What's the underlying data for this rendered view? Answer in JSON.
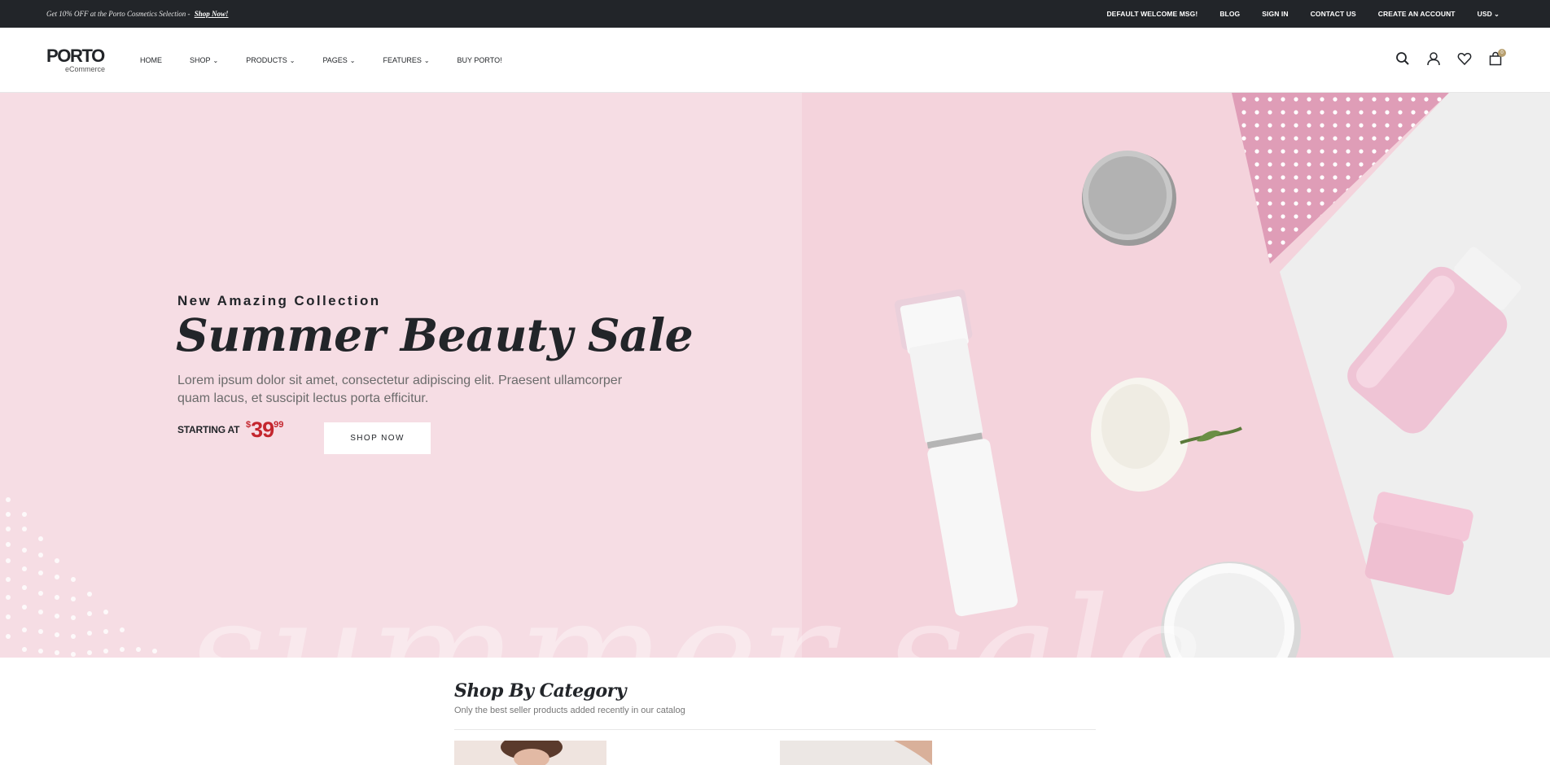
{
  "topbar": {
    "promo_text": "Get 10% OFF at the Porto Cosmetics Selection -",
    "promo_link": "Shop Now!",
    "links": [
      "DEFAULT WELCOME MSG!",
      "BLOG",
      "SIGN IN",
      "CONTACT US",
      "CREATE AN ACCOUNT",
      "USD"
    ]
  },
  "header": {
    "logo_brand": "PORTO",
    "logo_sub": "eCommerce",
    "nav": [
      {
        "label": "HOME",
        "chevron": false
      },
      {
        "label": "SHOP",
        "chevron": true
      },
      {
        "label": "PRODUCTS",
        "chevron": true
      },
      {
        "label": "PAGES",
        "chevron": true
      },
      {
        "label": "FEATURES",
        "chevron": true
      },
      {
        "label": "BUY PORTO!",
        "chevron": false
      }
    ],
    "icons": [
      "search-icon",
      "user-icon",
      "heart-icon",
      "cart-icon"
    ],
    "cart_count": "0"
  },
  "hero": {
    "subtitle": "New Amazing Collection",
    "title": "Summer Beauty Sale",
    "description": "Lorem ipsum dolor sit amet, consectetur adipiscing elit. Praesent ullamcorper quam lacus, et suscipit lectus porta efficitur.",
    "starting_label": "STARTING AT",
    "price_currency": "$",
    "price_int": "39",
    "price_dec": "99",
    "button_label": "SHOP NOW",
    "watermark": "summer sale"
  },
  "section": {
    "title": "Shop By Category",
    "subtitle": "Only the best seller products added recently in our catalog"
  },
  "colors": {
    "dark": "#222529",
    "price_red": "#c4262e",
    "hero_pink": "#f6dde4",
    "cart_badge": "#b8a070"
  }
}
